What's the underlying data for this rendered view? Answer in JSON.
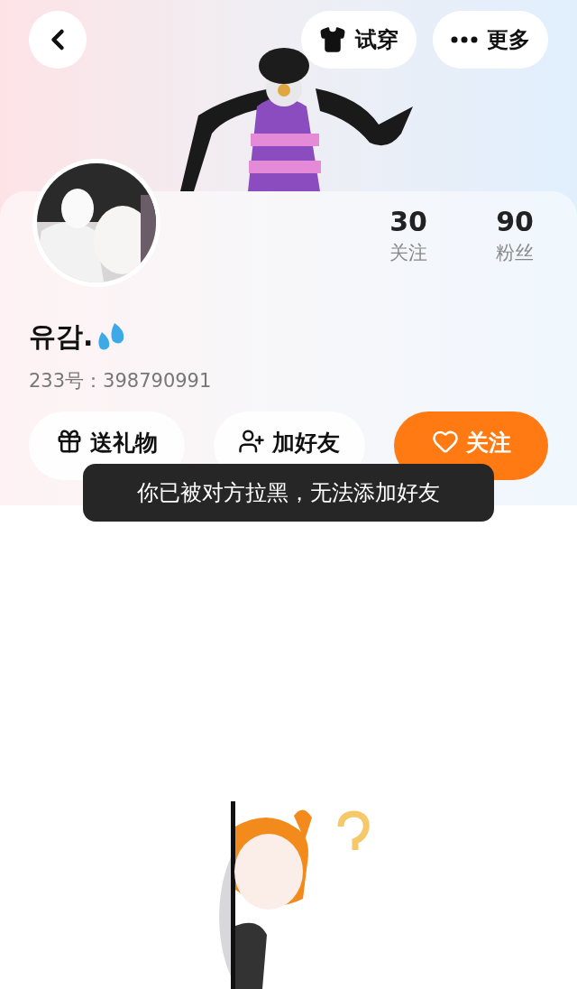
{
  "top_bar": {
    "buttons": [
      {
        "label": "试穿",
        "kind": "try-on"
      },
      {
        "label": "更多",
        "kind": "more"
      }
    ]
  },
  "profile": {
    "stats": [
      {
        "value": "30",
        "label": "关注"
      },
      {
        "value": "90",
        "label": "粉丝"
      }
    ],
    "name": "유감.",
    "id_line": "233号：398790991"
  },
  "actions": [
    {
      "label": "送礼物",
      "kind": "gift"
    },
    {
      "label": "加好友",
      "kind": "add-friend"
    },
    {
      "label": "关注",
      "kind": "follow"
    }
  ],
  "toast": "你已被对方拉黑，无法添加好友"
}
